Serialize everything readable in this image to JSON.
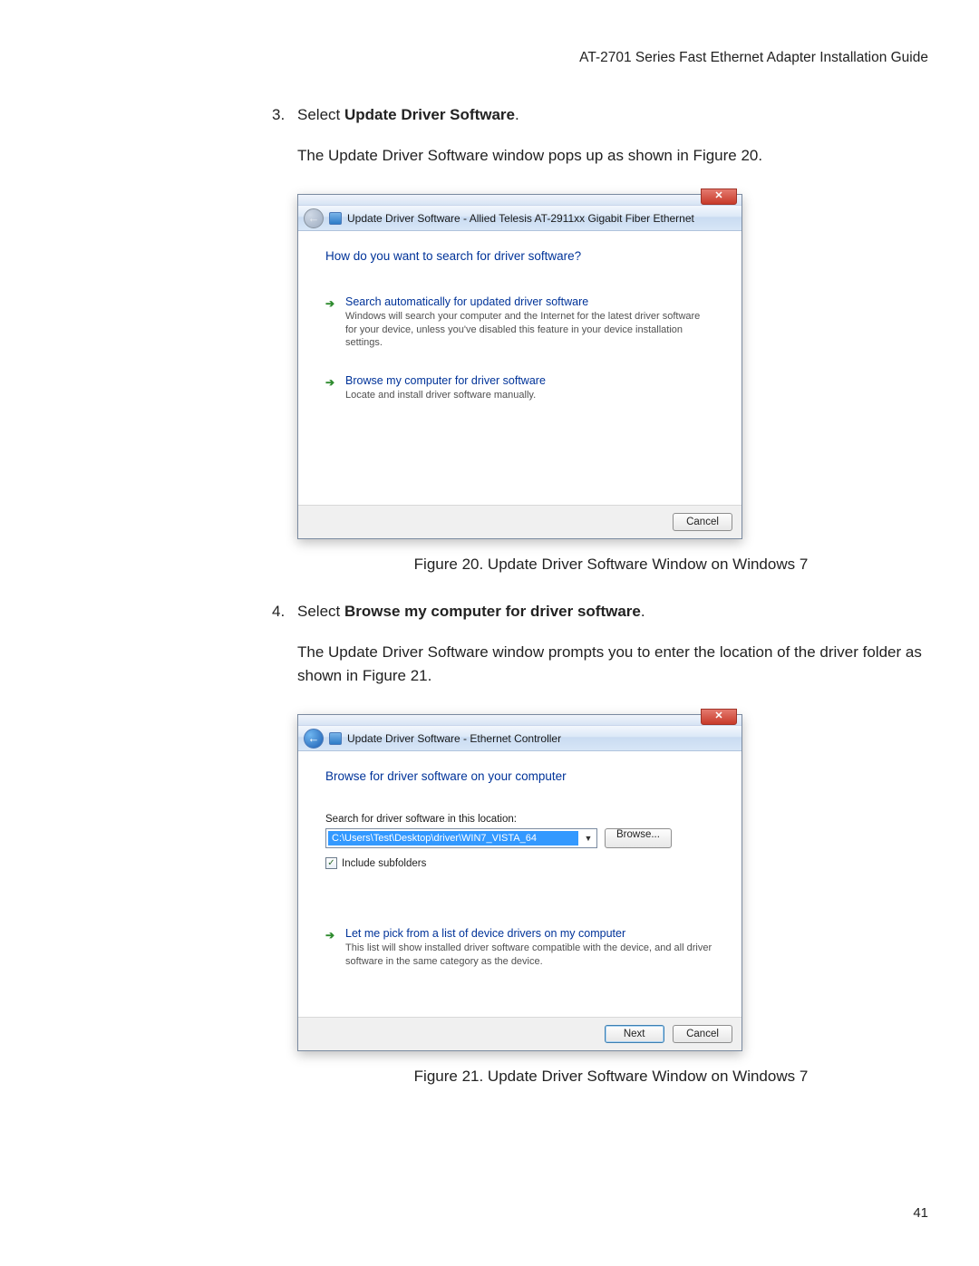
{
  "header": "AT-2701 Series Fast Ethernet Adapter Installation Guide",
  "page_number": "41",
  "step3": {
    "num": "3.",
    "prefix": "Select ",
    "bold": "Update Driver Software",
    "suffix": ".",
    "body": "The Update Driver Software window pops up as shown in Figure 20."
  },
  "fig20": {
    "caption": "Figure 20. Update Driver Software Window on Windows 7",
    "title": "Update Driver Software - Allied Telesis AT-2911xx Gigabit Fiber Ethernet",
    "heading": "How do you want to search for driver software?",
    "opt1_title": "Search automatically for updated driver software",
    "opt1_desc": "Windows will search your computer and the Internet for the latest driver software for your device, unless you've disabled this feature in your device installation settings.",
    "opt2_title": "Browse my computer for driver software",
    "opt2_desc": "Locate and install driver software manually.",
    "cancel": "Cancel"
  },
  "step4": {
    "num": "4.",
    "prefix": "Select ",
    "bold": "Browse my computer for driver software",
    "suffix": ".",
    "body": "The Update Driver Software window prompts you to enter the location of the driver folder as shown in Figure 21."
  },
  "fig21": {
    "caption": "Figure 21. Update Driver Software Window on Windows 7",
    "title": "Update Driver Software - Ethernet Controller",
    "heading": "Browse for driver software on your computer",
    "field_label": "Search for driver software in this location:",
    "path": "C:\\Users\\Test\\Desktop\\driver\\WIN7_VISTA_64",
    "browse": "Browse...",
    "include": "Include subfolders",
    "opt_title": "Let me pick from a list of device drivers on my computer",
    "opt_desc": "This list will show installed driver software compatible with the device, and all driver software in the same category as the device.",
    "next": "Next",
    "cancel": "Cancel"
  }
}
